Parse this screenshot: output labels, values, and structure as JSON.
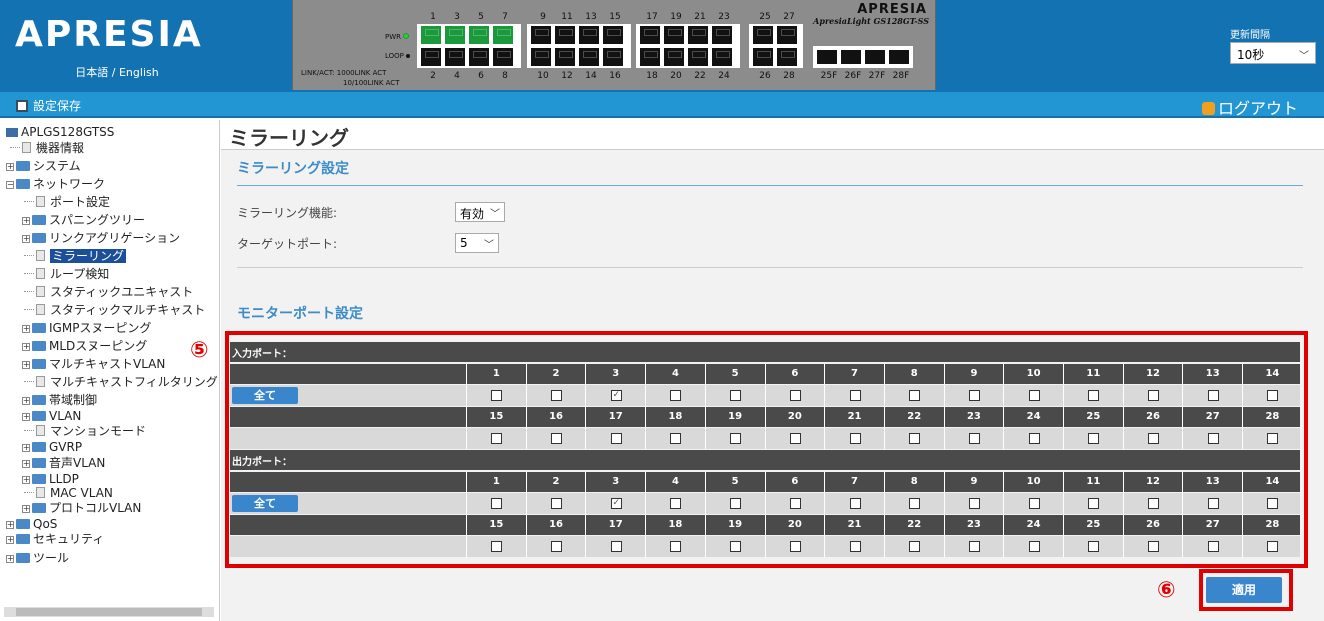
{
  "header": {
    "logo": "APRESIA",
    "lang_label": "日本語 / English",
    "device_brand": "APRESIA",
    "device_model": "ApresiaLight GS128GT-SS",
    "led": {
      "pwr": "PWR",
      "loop": "LOOP",
      "legend1": "LINK/ACT:  1000LINK    ACT",
      "legend2": "10/100LINK    ACT"
    },
    "port_top": [
      "1",
      "3",
      "5",
      "7",
      "9",
      "11",
      "13",
      "15",
      "17",
      "19",
      "21",
      "23",
      "25",
      "27"
    ],
    "port_bottom": [
      "2",
      "4",
      "6",
      "8",
      "10",
      "12",
      "14",
      "16",
      "18",
      "20",
      "22",
      "24",
      "26",
      "28"
    ],
    "sfp_labels": [
      "25F",
      "26F",
      "27F",
      "28F"
    ],
    "refresh_label": "更新間隔",
    "refresh_value": "10秒"
  },
  "toolbar": {
    "save_label": "設定保存",
    "logout_label": "ログアウト"
  },
  "sidebar": {
    "items": [
      "APLGS128GTSS",
      "機器情報",
      "システム",
      "ネットワーク",
      "ポート設定",
      "スパニングツリー",
      "リンクアグリゲーション",
      "ミラーリング",
      "ループ検知",
      "スタティックユニキャスト",
      "スタティックマルチキャスト",
      "IGMPスヌーピング",
      "MLDスヌーピング",
      "マルチキャストVLAN",
      "マルチキャストフィルタリング",
      "帯域制御",
      "VLAN",
      "マンションモード",
      "GVRP",
      "音声VLAN",
      "LLDP",
      "MAC VLAN",
      "プロトコルVLAN",
      "QoS",
      "セキュリティ",
      "ツール"
    ]
  },
  "main": {
    "title": "ミラーリング",
    "settings_title": "ミラーリング設定",
    "mirroring_label": "ミラーリング機能:",
    "mirroring_value": "有効",
    "target_label": "ターゲットポート:",
    "target_value": "5",
    "monitor_title": "モニターポート設定",
    "input_label": "入力ポート：",
    "output_label": "出力ポート：",
    "all_label": "全て",
    "ports_row1": [
      "1",
      "2",
      "3",
      "4",
      "5",
      "6",
      "7",
      "8",
      "9",
      "10",
      "11",
      "12",
      "13",
      "14"
    ],
    "ports_row2": [
      "15",
      "16",
      "17",
      "18",
      "19",
      "20",
      "21",
      "22",
      "23",
      "24",
      "25",
      "26",
      "27",
      "28"
    ],
    "input_checked": [
      "3"
    ],
    "output_checked": [
      "3"
    ],
    "apply_label": "適用",
    "marker5": "⑤",
    "marker6": "⑥"
  }
}
